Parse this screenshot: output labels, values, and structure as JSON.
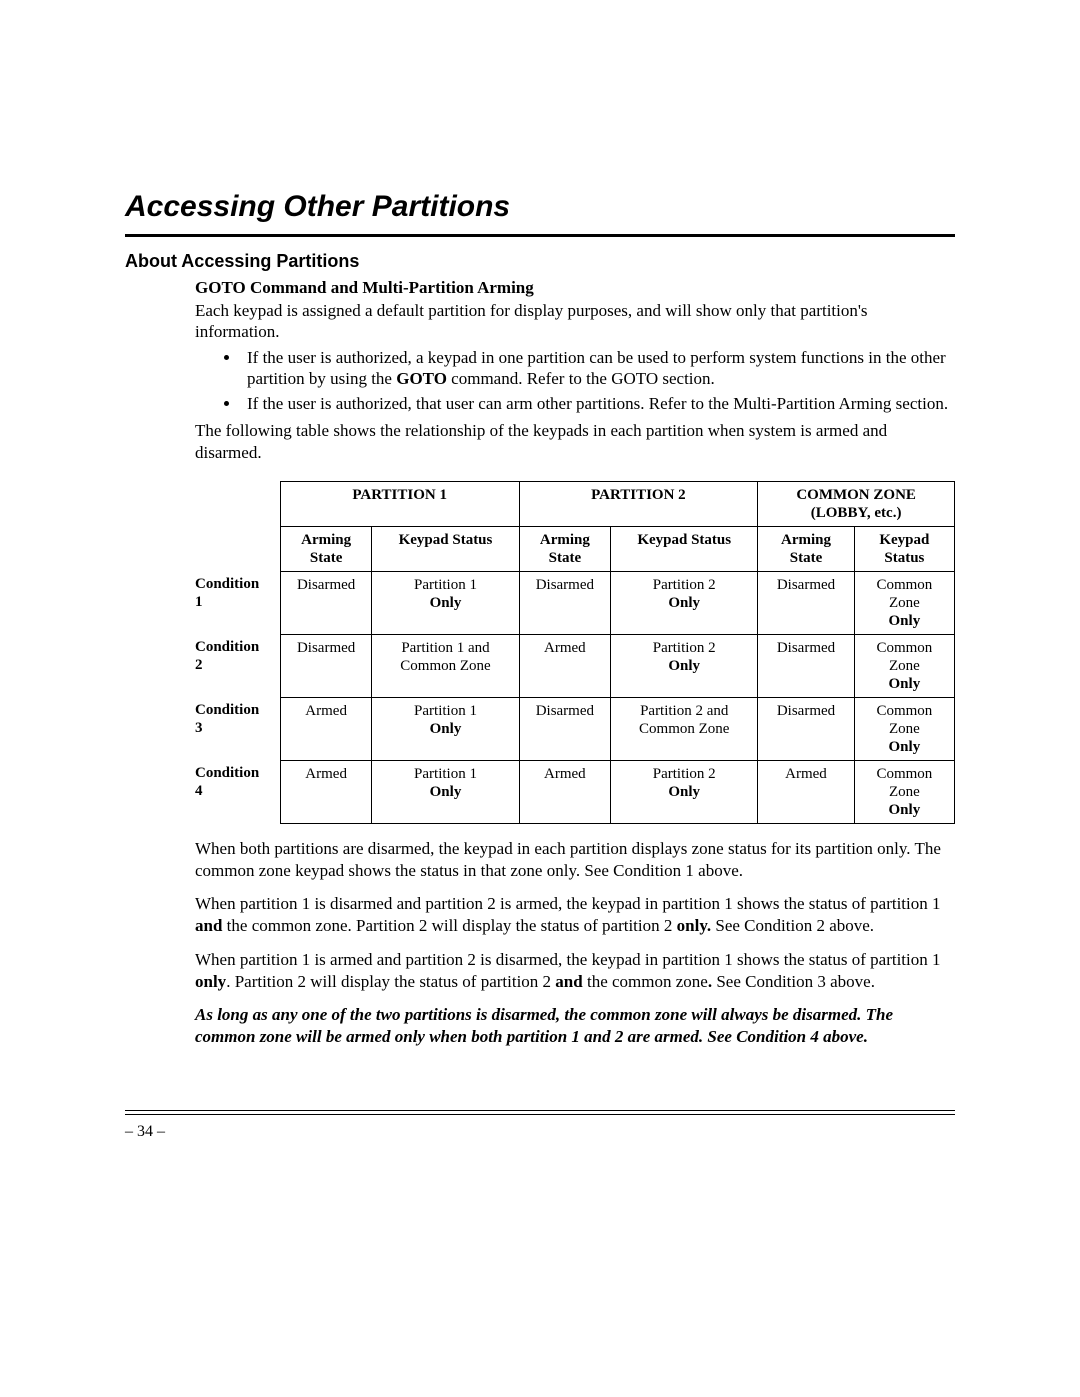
{
  "title": "Accessing Other Partitions",
  "section_head": "About Accessing Partitions",
  "sub_head": "GOTO Command and Multi-Partition Arming",
  "intro": "Each keypad is assigned a default partition for display purposes, and will show only that partition's information.",
  "bullet1_a": "If the user is authorized, a keypad in one partition can be used to perform system functions in the other partition by using the ",
  "bullet1_bold": "GOTO",
  "bullet1_b": " command. Refer to the GOTO section.",
  "bullet2": "If the user is authorized, that user can arm other partitions. Refer to the Multi-Partition Arming section.",
  "table_intro": "The following table shows the relationship of the keypads in each partition when system is armed and disarmed.",
  "table": {
    "group_headers": [
      "PARTITION 1",
      "PARTITION 2",
      "COMMON ZONE (LOBBY, etc.)"
    ],
    "sub_headers": [
      "Arming State",
      "Keypad Status",
      "Arming State",
      "Keypad Status",
      "Arming State",
      "Keypad Status"
    ],
    "rows": [
      {
        "label": "Condition 1",
        "cells": [
          {
            "a": "Disarmed"
          },
          {
            "a": "Partition 1",
            "b": "Only"
          },
          {
            "a": "Disarmed"
          },
          {
            "a": "Partition 2",
            "b": "Only"
          },
          {
            "a": "Disarmed"
          },
          {
            "a": "Common Zone",
            "b": "Only"
          }
        ]
      },
      {
        "label": "Condition 2",
        "cells": [
          {
            "a": "Disarmed"
          },
          {
            "a": "Partition 1 and Common Zone"
          },
          {
            "a": "Armed"
          },
          {
            "a": "Partition 2",
            "b": "Only"
          },
          {
            "a": "Disarmed"
          },
          {
            "a": "Common Zone",
            "b": "Only"
          }
        ]
      },
      {
        "label": "Condition 3",
        "cells": [
          {
            "a": "Armed"
          },
          {
            "a": "Partition 1",
            "b": "Only"
          },
          {
            "a": "Disarmed"
          },
          {
            "a": "Partition 2 and Common Zone"
          },
          {
            "a": "Disarmed"
          },
          {
            "a": "Common Zone",
            "b": "Only"
          }
        ]
      },
      {
        "label": "Condition 4",
        "cells": [
          {
            "a": "Armed"
          },
          {
            "a": "Partition 1",
            "b": "Only"
          },
          {
            "a": "Armed"
          },
          {
            "a": "Partition 2",
            "b": "Only"
          },
          {
            "a": "Armed"
          },
          {
            "a": "Common Zone",
            "b": "Only"
          }
        ]
      }
    ]
  },
  "para1": "When both partitions are disarmed, the keypad in each partition displays zone status for its partition only. The common zone keypad shows the status in that zone only. See Condition 1 above.",
  "para2_a": "When partition 1 is disarmed and partition 2 is armed, the keypad in partition 1 shows the status of partition 1 ",
  "para2_b1": "and",
  "para2_b": " the common zone. Partition 2 will display the status of partition 2 ",
  "para2_b2": "only.",
  "para2_c": " See Condition 2 above.",
  "para3_a": "When partition 1 is armed and partition 2 is disarmed, the keypad in partition 1 shows the status of partition 1 ",
  "para3_b1": "only",
  "para3_b": ". Partition 2 will display the status of partition 2 ",
  "para3_b2": "and",
  "para3_c": " the common zone",
  "para3_b3": ".",
  "para3_d": " See Condition 3 above.",
  "para4": "As long as any one of the two partitions is disarmed, the common zone will always be disarmed. The common zone will be armed only when both partition 1 and 2 are armed. See Condition 4 above.",
  "page_number": "– 34 –"
}
